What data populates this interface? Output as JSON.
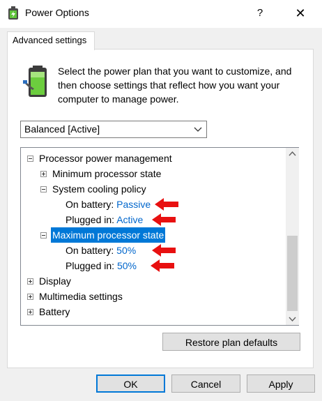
{
  "window": {
    "title": "Power Options",
    "help_label": "?",
    "close_label": "✕"
  },
  "tab": {
    "label": "Advanced settings"
  },
  "description": "Select the power plan that you want to customize, and then choose settings that reflect how you want your computer to manage power.",
  "plan_select": {
    "value": "Balanced [Active]"
  },
  "tree": {
    "processor_power_management": "Processor power management",
    "minimum_processor_state": "Minimum processor state",
    "system_cooling_policy": {
      "label": "System cooling policy",
      "on_battery_label": "On battery:",
      "on_battery_value": "Passive",
      "plugged_in_label": "Plugged in:",
      "plugged_in_value": "Active"
    },
    "maximum_processor_state": {
      "label": "Maximum processor state",
      "on_battery_label": "On battery:",
      "on_battery_value": "50%",
      "plugged_in_label": "Plugged in:",
      "plugged_in_value": "50%"
    },
    "display": "Display",
    "multimedia_settings": "Multimedia settings",
    "battery": "Battery"
  },
  "buttons": {
    "restore": "Restore plan defaults",
    "ok": "OK",
    "cancel": "Cancel",
    "apply": "Apply"
  },
  "colors": {
    "link": "#0066cc",
    "selection": "#0078d7",
    "annotation_arrow": "#e81010"
  }
}
